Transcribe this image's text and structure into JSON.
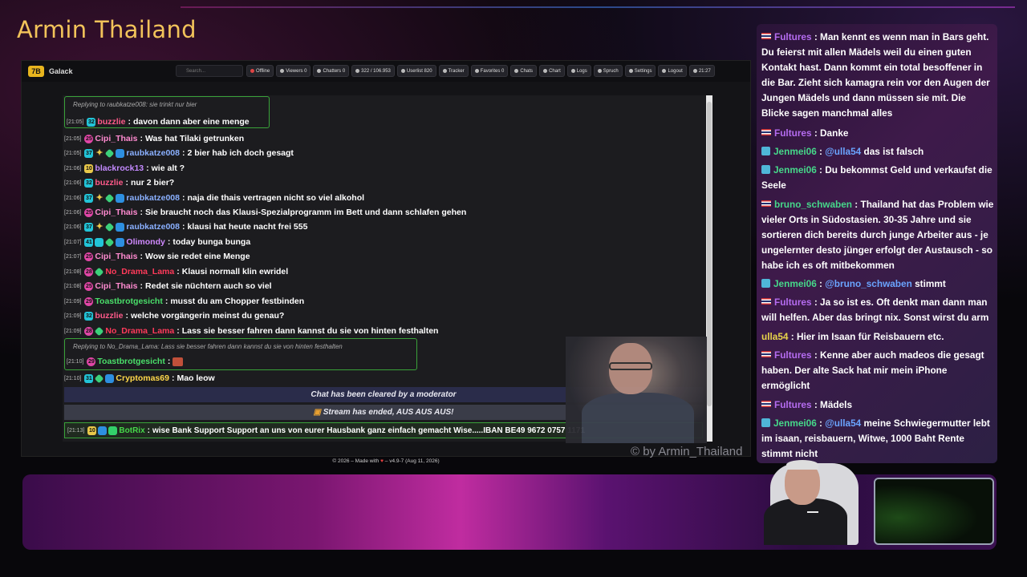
{
  "overlay": {
    "title": "Armin Thailand",
    "watermark": "© by Armin_Thailand"
  },
  "app": {
    "name": "Galack",
    "logo": "7B",
    "search_placeholder": "Search...",
    "nav": [
      {
        "name": "offline",
        "label": "Offline"
      },
      {
        "name": "viewers",
        "label": "Viewers 0"
      },
      {
        "name": "chatters",
        "label": "Chatters 0"
      },
      {
        "name": "messages",
        "label": "322 / 106.953"
      },
      {
        "name": "userlist",
        "label": "Userlist 820"
      },
      {
        "name": "tracker",
        "label": "Tracker"
      },
      {
        "name": "favorites",
        "label": "Favorites 0"
      },
      {
        "name": "chats",
        "label": "Chats"
      },
      {
        "name": "chart",
        "label": "Chart"
      },
      {
        "name": "logs",
        "label": "Logs"
      },
      {
        "name": "spruch",
        "label": "Spruch"
      },
      {
        "name": "settings",
        "label": "Settings"
      },
      {
        "name": "logout",
        "label": "Logout"
      },
      {
        "name": "clock",
        "label": "21:27"
      }
    ],
    "footer": {
      "pre": "© 2026 – Made with",
      "post": "– v4.9-7 (Aug 11, 2026)"
    }
  },
  "chat": {
    "replies": [
      {
        "text": "Replying to raubkatze008: sie trinkt nur bier"
      },
      {
        "text": "Replying to No_Drama_Lama: Lass sie besser fahren dann kannst du sie von hinten festhalten"
      }
    ],
    "messages": [
      {
        "time": "[21:05]",
        "badge": "32",
        "user": "buzzlie",
        "color": "#ff5a8a",
        "text": "davon dann aber eine menge"
      },
      {
        "time": "[21:05]",
        "badge": "25",
        "user": "Cipi_Thais",
        "color": "#ff8ad0",
        "text": "Was hat Tilaki getrunken"
      },
      {
        "time": "[21:05]",
        "badge": "37",
        "user": "raubkatze008",
        "color": "#8ab0ff",
        "text": "2 bier hab ich doch gesagt"
      },
      {
        "time": "[21:06]",
        "badge": "10",
        "user": "blackrock13",
        "color": "#c48aff",
        "text": "wie alt ?"
      },
      {
        "time": "[21:06]",
        "badge": "32",
        "user": "buzzlie",
        "color": "#ff5a8a",
        "text": "nur 2 bier?"
      },
      {
        "time": "[21:06]",
        "badge": "37",
        "user": "raubkatze008",
        "color": "#8ab0ff",
        "text": "naja die thais vertragen nicht so viel alkohol"
      },
      {
        "time": "[21:06]",
        "badge": "25",
        "user": "Cipi_Thais",
        "color": "#ff8ad0",
        "text": "Sie braucht noch das Klausi-Spezialprogramm im Bett und dann schlafen gehen"
      },
      {
        "time": "[21:06]",
        "badge": "37",
        "user": "raubkatze008",
        "color": "#8ab0ff",
        "text": "klausi hat heute nacht frei 555"
      },
      {
        "time": "[21:07]",
        "badge": "41",
        "user": "Olimondy",
        "color": "#d08aff",
        "text": "today bunga bunga"
      },
      {
        "time": "[21:07]",
        "badge": "25",
        "user": "Cipi_Thais",
        "color": "#ff8ad0",
        "text": "Wow sie redet eine Menge"
      },
      {
        "time": "[21:08]",
        "badge": "28",
        "user": "No_Drama_Lama",
        "color": "#ff3a5a",
        "text": "Klausi normall klin ewridel"
      },
      {
        "time": "[21:08]",
        "badge": "25",
        "user": "Cipi_Thais",
        "color": "#ff8ad0",
        "text": "Redet sie nüchtern auch so viel"
      },
      {
        "time": "[21:09]",
        "badge": "29",
        "user": "Toastbrotgesicht",
        "color": "#4adf6a",
        "text": "musst du am Chopper festbinden"
      },
      {
        "time": "[21:09]",
        "badge": "32",
        "user": "buzzlie",
        "color": "#ff5a8a",
        "text": "welche vorgängerin meinst du genau?"
      },
      {
        "time": "[21:09]",
        "badge": "28",
        "user": "No_Drama_Lama",
        "color": "#ff3a5a",
        "text": "Lass sie besser fahren dann kannst du sie von hinten festhalten"
      },
      {
        "time": "[21:10]",
        "badge": "29",
        "user": "Toastbrotgesicht",
        "color": "#4adf6a",
        "text": ""
      },
      {
        "time": "[21:10]",
        "badge": "31",
        "user": "Cryptomas69",
        "color": "#ffd84a",
        "text": "Mao leow"
      }
    ],
    "system": {
      "cleared": "Chat has been cleared by a moderator",
      "ended": "Stream has ended, AUS AUS AUS!"
    },
    "bot": {
      "time": "[21:13]",
      "badge": "10",
      "user": "BotRix",
      "text": "wise Bank Support Support an uns von eurer Hausbank ganz einfach gemacht Wise.....IBAN BE49 9672 0757 1171"
    }
  },
  "side_chat": [
    {
      "user": "Fultures",
      "sep": " : ",
      "text": "Man kennt es wenn man in Bars geht. Du feierst mit allen Mädels weil du einen guten Kontakt hast. Dann kommt ein total besoffener in die Bar. Zieht sich kamagra rein vor den Augen der Jungen Mädels und dann müssen sie mit. Die Blicke sagen manchmal alles"
    },
    {
      "user": "Fultures",
      "sep": " : ",
      "text": "Danke"
    },
    {
      "user": "Jenmei06",
      "sep": " : ",
      "mention": "@ulla54",
      "text": " das ist falsch"
    },
    {
      "user": "Jenmei06",
      "sep": " : ",
      "text": "Du bekommst Geld und verkaufst die Seele"
    },
    {
      "user": "bruno_schwaben",
      "sep": " : ",
      "text": "Thailand hat das Problem wie vieler Orts in Südostasien. 30-35 Jahre und sie sortieren dich bereits durch junge Arbeiter aus - je ungelernter desto jünger erfolgt der Austausch - so habe ich es oft mitbekommen"
    },
    {
      "user": "Jenmei06",
      "sep": " : ",
      "mention": "@bruno_schwaben",
      "text": " stimmt"
    },
    {
      "user": "Fultures",
      "sep": " : ",
      "text": "Ja so ist es. Oft denkt man dann man will helfen. Aber das bringt nix. Sonst wirst du arm"
    },
    {
      "user": "ulla54",
      "sep": " : ",
      "text": "Hier im Isaan für Reisbauern etc."
    },
    {
      "user": "Fultures",
      "sep": " : ",
      "text": "Kenne aber auch madeos die gesagt haben. Der alte Sack hat mir mein iPhone ermöglicht"
    },
    {
      "user": "Fultures",
      "sep": " : ",
      "text": "Mädels"
    },
    {
      "user": "Jenmei06",
      "sep": " : ",
      "mention": "@ulla54",
      "text": " meine Schwiegermutter lebt im isaan, reisbauern, Witwe, 1000 Baht Rente stimmt nicht"
    }
  ],
  "colors": {
    "accent": "#f2c35a",
    "reply_border": "#3aa33a",
    "panel": "#3e1a4a"
  }
}
